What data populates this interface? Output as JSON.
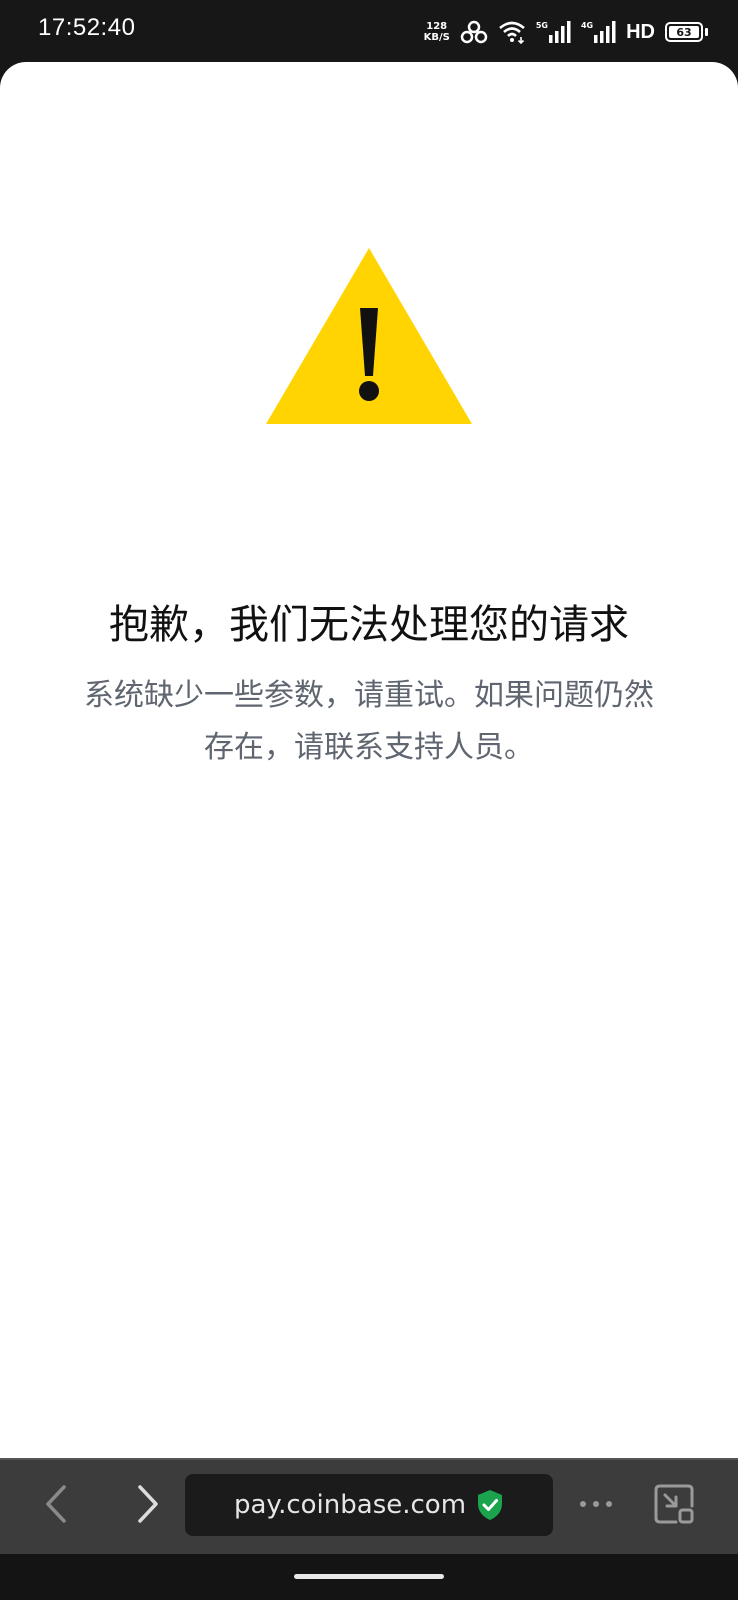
{
  "status_bar": {
    "time": "17:52:40",
    "net_speed_value": "128",
    "net_speed_unit": "KB/S",
    "signal_1_label": "5G",
    "signal_2_label": "4G",
    "hd_label": "HD",
    "battery_level": "63",
    "icons": [
      "hotspot-icon",
      "wifi-icon",
      "signal-icon",
      "battery-icon"
    ]
  },
  "error_page": {
    "icon": "warning-icon",
    "title": "抱歉，我们无法处理您的请求",
    "message_line_1": "系统缺少一些参数，请重试。如果问题仍然",
    "message_line_2": "存在，请联系支持人员。"
  },
  "browser_toolbar": {
    "url": "pay.coinbase.com",
    "icons": [
      "back-icon",
      "forward-icon",
      "secure-shield-icon",
      "more-icon",
      "minimize-window-icon"
    ]
  },
  "colors": {
    "warning_yellow": "#FFD400",
    "secure_green": "#1BA34E",
    "message_gray": "#5F6670",
    "toolbar_bg": "#3C3C3C"
  }
}
